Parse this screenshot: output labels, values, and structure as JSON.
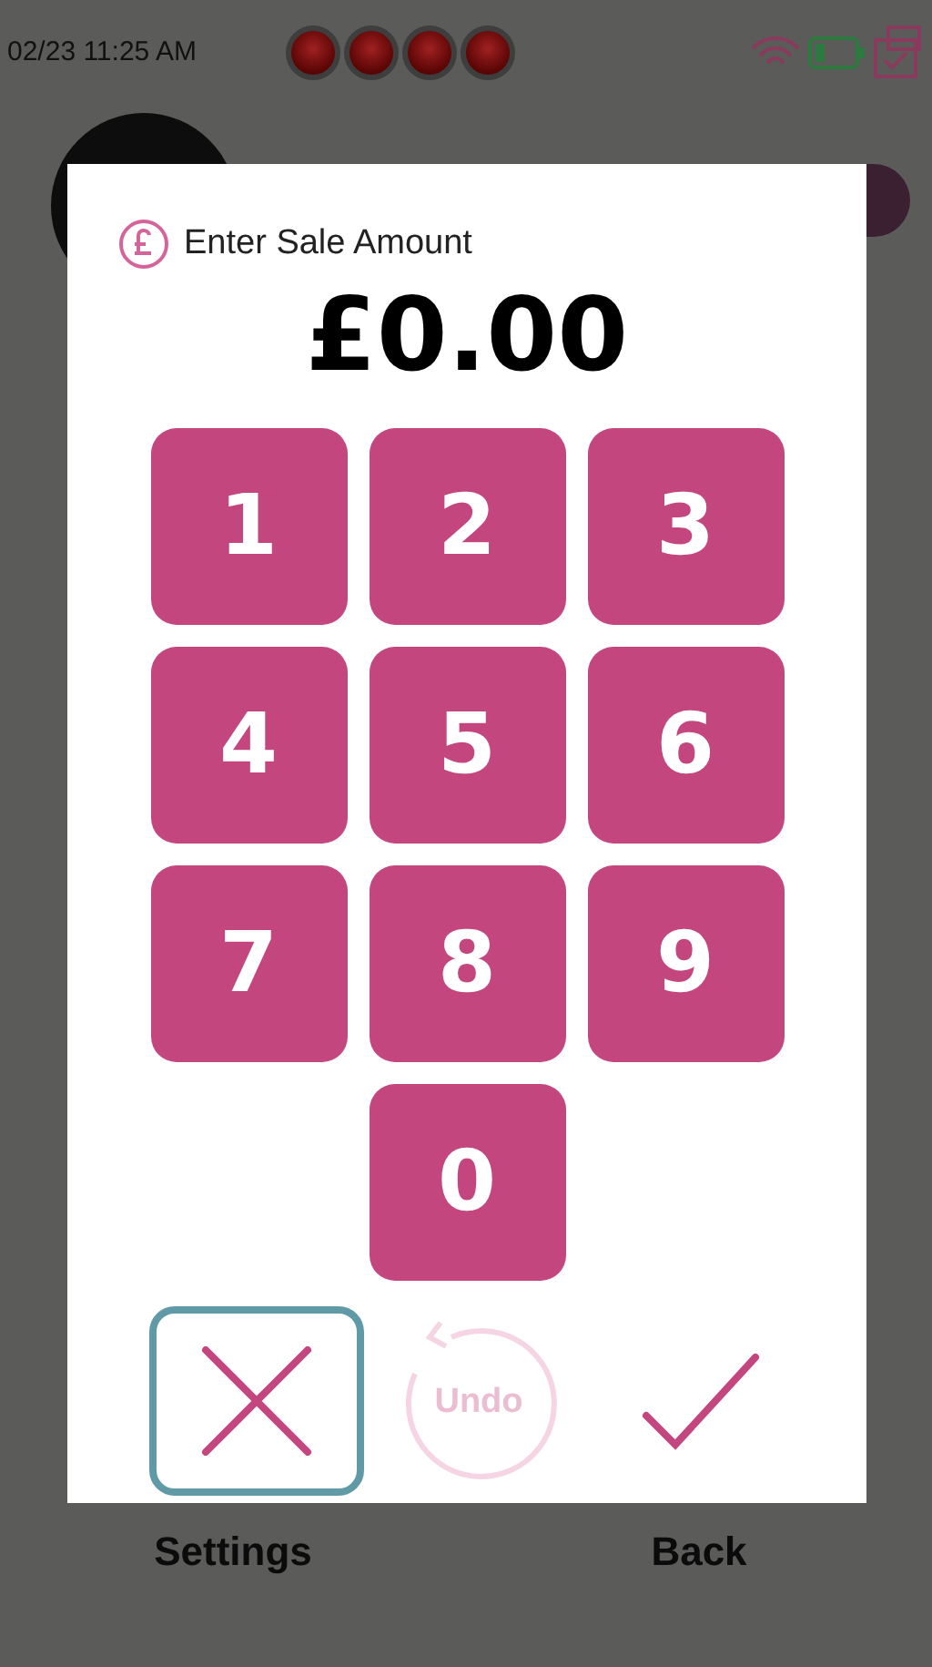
{
  "status_bar": {
    "time": "02/23 11:25 AM"
  },
  "dialog": {
    "title": "Enter Sale Amount",
    "amount": "£0.00",
    "keys": [
      "1",
      "2",
      "3",
      "4",
      "5",
      "6",
      "7",
      "8",
      "9",
      "0"
    ],
    "actions": [
      {
        "kind": "cancel",
        "focused": true,
        "disabled": false
      },
      {
        "kind": "undo",
        "label": "Undo",
        "focused": false,
        "disabled": true
      },
      {
        "kind": "confirm",
        "focused": false,
        "disabled": false
      }
    ]
  },
  "bottom_buttons": [
    "Settings",
    "Back"
  ]
}
